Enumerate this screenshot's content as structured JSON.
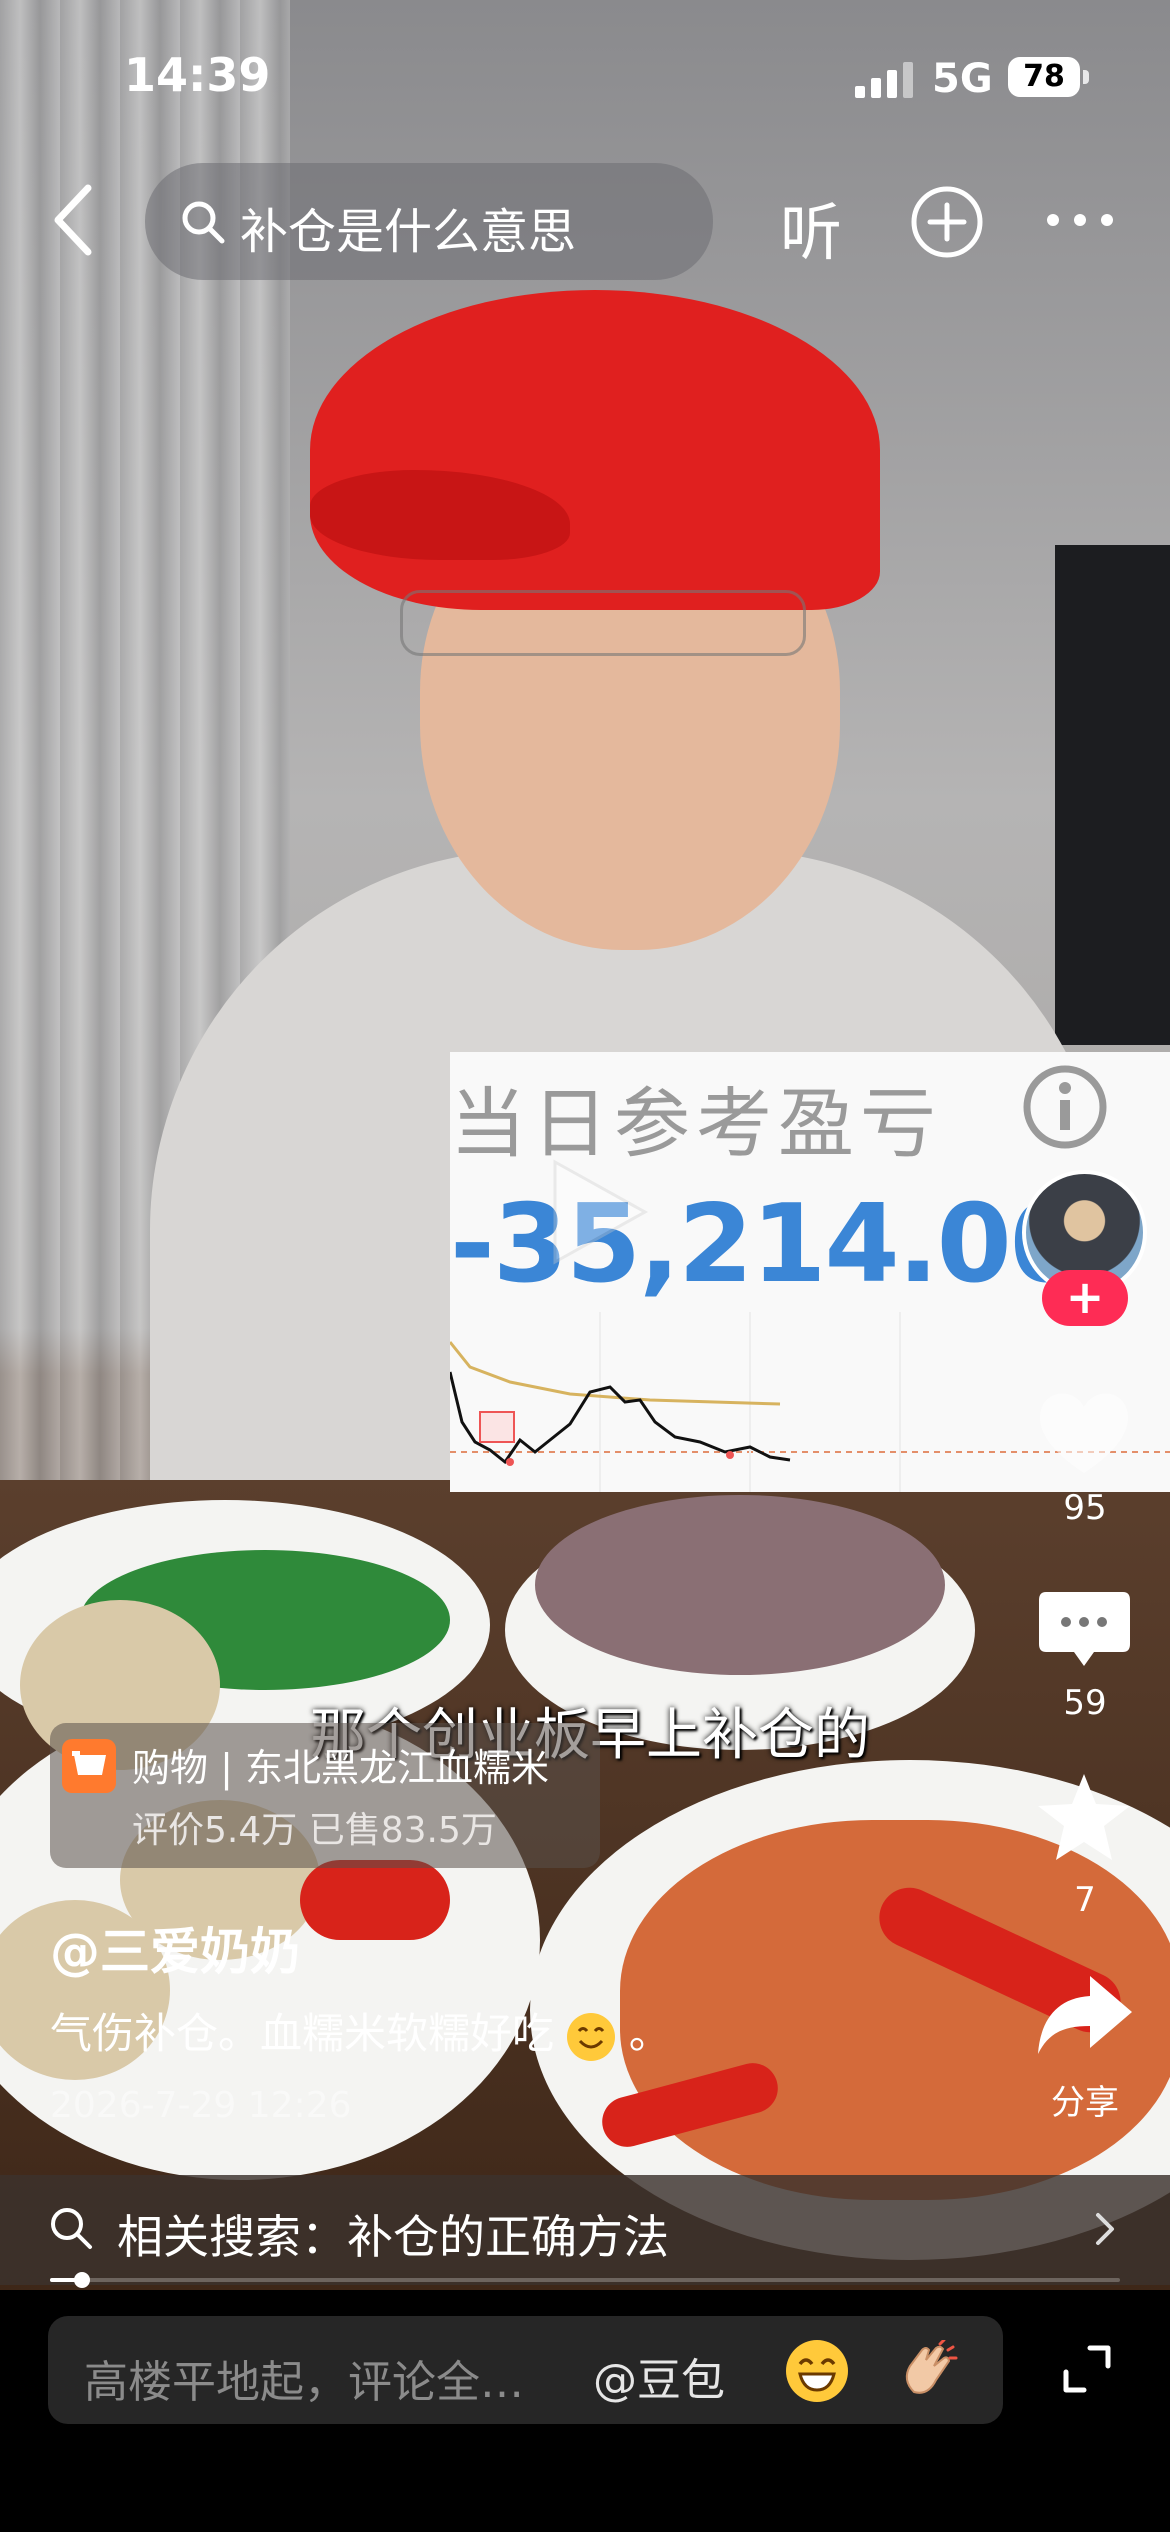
{
  "status_bar": {
    "time": "14:39",
    "network": "5G",
    "battery": "78"
  },
  "top_nav": {
    "search_text": "补仓是什么意思",
    "listen_label": "听"
  },
  "overlay_chart": {
    "label": "当日参考盈亏",
    "value": "-35,214.00"
  },
  "right_rail": {
    "like_count": "95",
    "comment_count": "59",
    "favorite_count": "7",
    "share_label": "分享"
  },
  "video": {
    "subtitle": "那个创业板早上补仓的"
  },
  "product": {
    "title": "购物 | 东北黑龙江血糯米",
    "stats": "评价5.4万 已售83.5万"
  },
  "post": {
    "author": "@三爱奶奶",
    "description": "气伤补仓。血糯米软糯好吃",
    "description_suffix": "。",
    "date": "2026-7-29 12:26"
  },
  "related_search": {
    "text": "相关搜索：补仓的正确方法"
  },
  "playback": {
    "progress": 0.03
  },
  "comment_bar": {
    "placeholder": "高楼平地起，评论全…",
    "mention": "@豆包"
  },
  "colors": {
    "accent": "#fe2c55",
    "chart_value": "#3b86d6",
    "cart": "#ff7a2e"
  }
}
